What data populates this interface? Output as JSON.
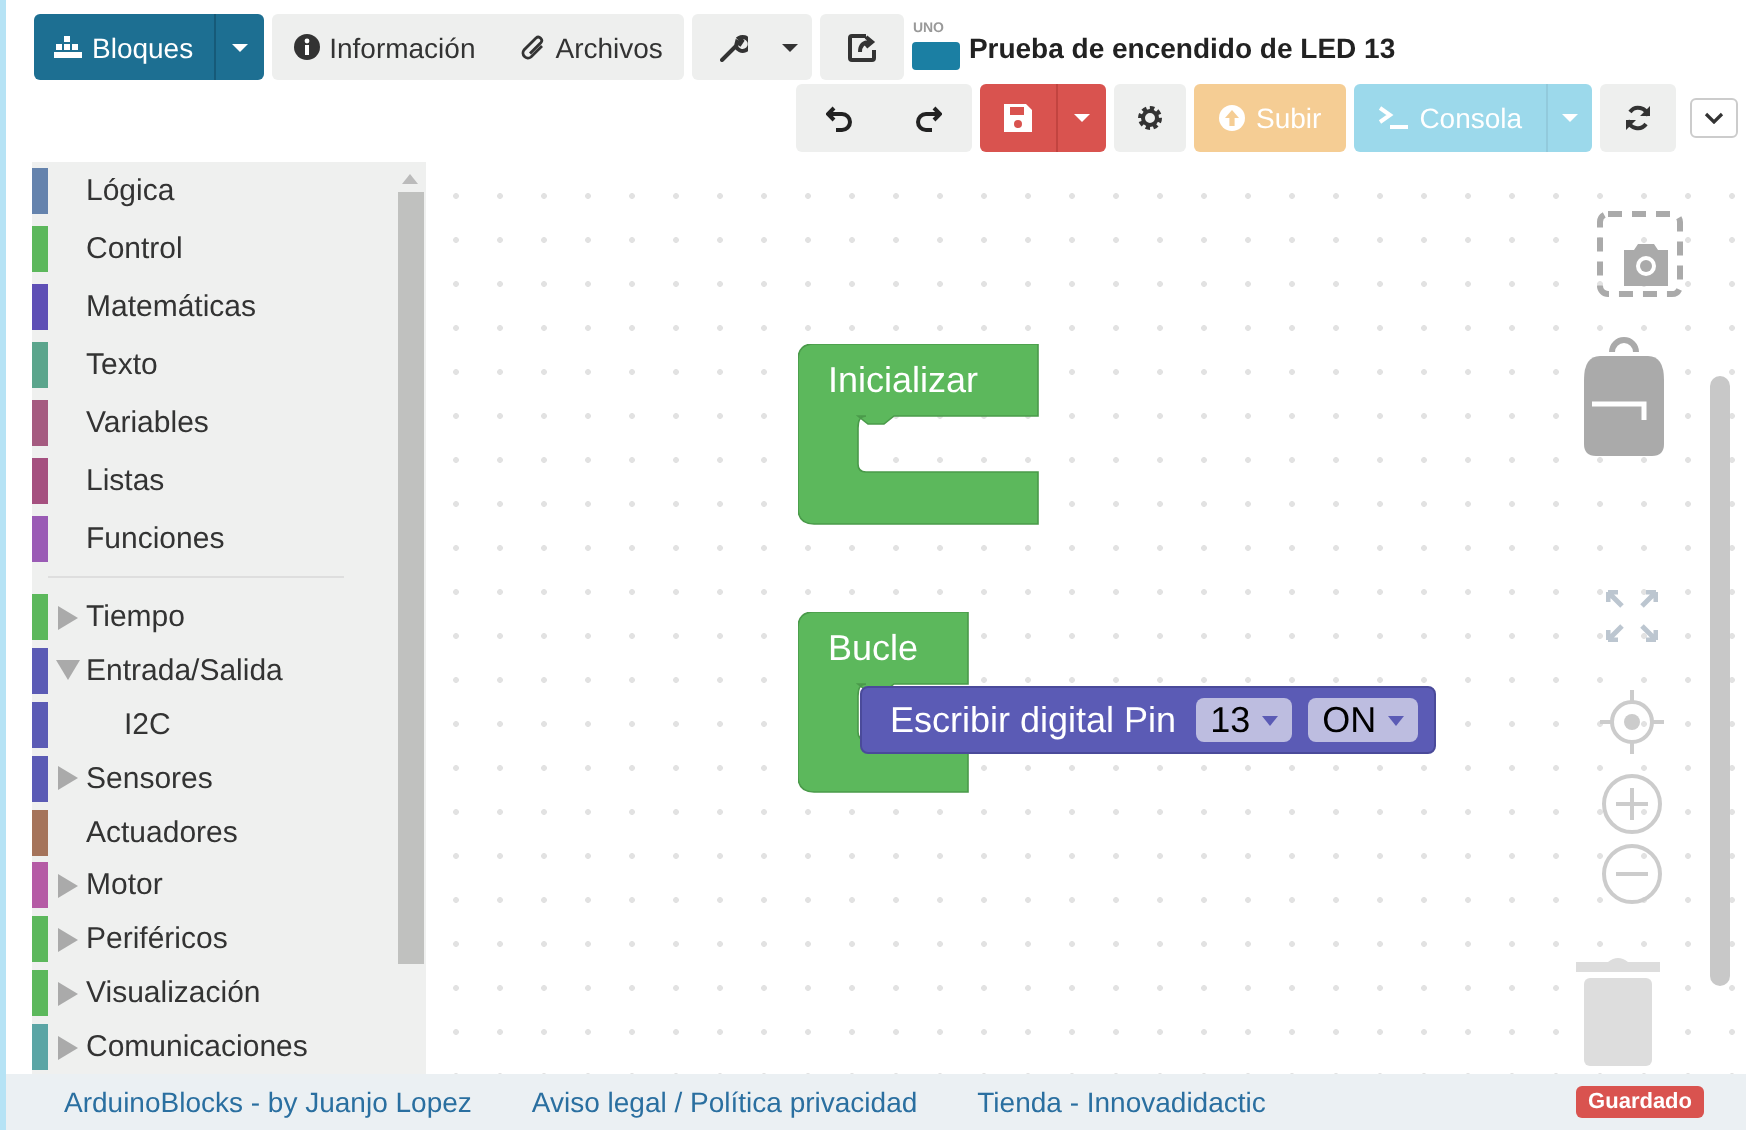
{
  "toolbar": {
    "mode": {
      "label": "Bloques"
    },
    "tabs": [
      {
        "label": "Información"
      },
      {
        "label": "Archivos"
      }
    ],
    "project": {
      "board": "UNO",
      "title": "Prueba de encendido de LED 13"
    }
  },
  "actions": {
    "upload": {
      "label": "Subir",
      "disabled": true
    },
    "console": {
      "label": "Consola",
      "disabled": true
    }
  },
  "sidebar": {
    "groups": [
      {
        "categories": [
          {
            "label": "Lógica",
            "color": "#6583ad"
          },
          {
            "label": "Control",
            "color": "#5cb85c"
          },
          {
            "label": "Matemáticas",
            "color": "#5e4fb5"
          },
          {
            "label": "Texto",
            "color": "#5ba58c"
          },
          {
            "label": "Variables",
            "color": "#a55b80"
          },
          {
            "label": "Listas",
            "color": "#a5507f"
          },
          {
            "label": "Funciones",
            "color": "#9a5bb5"
          }
        ]
      },
      {
        "categories": [
          {
            "label": "Tiempo",
            "color": "#5cb85c",
            "expanded": false
          },
          {
            "label": "Entrada/Salida",
            "color": "#5b5bb5",
            "expanded": true,
            "children": [
              {
                "label": "I2C",
                "color": "#5b5bb5"
              }
            ]
          },
          {
            "label": "Sensores",
            "color": "#5b5bb5",
            "expanded": false
          },
          {
            "label": "Actuadores",
            "color": "#a5745b"
          },
          {
            "label": "Motor",
            "color": "#b55ba5",
            "expanded": false
          },
          {
            "label": "Periféricos",
            "color": "#5cb85c",
            "expanded": false
          },
          {
            "label": "Visualización",
            "color": "#5cb85c",
            "expanded": false
          },
          {
            "label": "Comunicaciones",
            "color": "#5ba5a5",
            "expanded": false
          }
        ]
      }
    ]
  },
  "workspace": {
    "blocks": [
      {
        "kind": "event",
        "label": "Inicializar"
      },
      {
        "kind": "event",
        "label": "Bucle",
        "children": [
          {
            "kind": "command",
            "label": "Escribir digital Pin",
            "fields": [
              {
                "value": "13"
              },
              {
                "value": "ON"
              }
            ]
          }
        ]
      }
    ]
  },
  "footer": {
    "links": [
      "ArduinoBlocks - by Juanjo Lopez",
      "Aviso legal / Política privacidad",
      "Tienda - Innovadidactic"
    ],
    "status_badge": "Guardado"
  }
}
